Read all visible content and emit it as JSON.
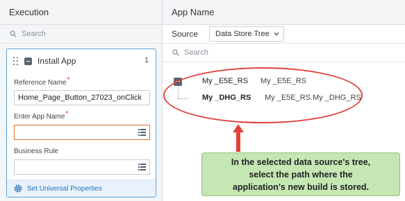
{
  "left_panel": {
    "title": "Execution",
    "search_placeholder": "Search",
    "card": {
      "title": "Install App",
      "number": "1",
      "fields": [
        {
          "label": "Reference Name",
          "required": "*",
          "value": "Home_Page_Button_27023_onClick"
        },
        {
          "label": "Enter App Name",
          "required": "*",
          "value": ""
        },
        {
          "label": "Business Rule",
          "required": "",
          "value": ""
        }
      ],
      "universal_link": "Set Universal Properties"
    }
  },
  "right_panel": {
    "title": "App Name",
    "source_label": "Source",
    "source_value": "Data Store Tree",
    "search_placeholder": "Search",
    "tree": [
      {
        "name": "My _E5E_RS",
        "path": "My _E5E_RS"
      },
      {
        "name": "My _DHG_RS",
        "path": "My _E5E_RS.My _DHG_RS"
      }
    ]
  },
  "callout": {
    "lines": [
      "In the selected data source's tree,",
      "select the path where the",
      "application's new build is stored."
    ]
  },
  "colors": {
    "accent": "#1f6fbf",
    "highlight": "#e2403a",
    "callout_bg": "#c5e7b4",
    "error_border": "#e0722a"
  }
}
